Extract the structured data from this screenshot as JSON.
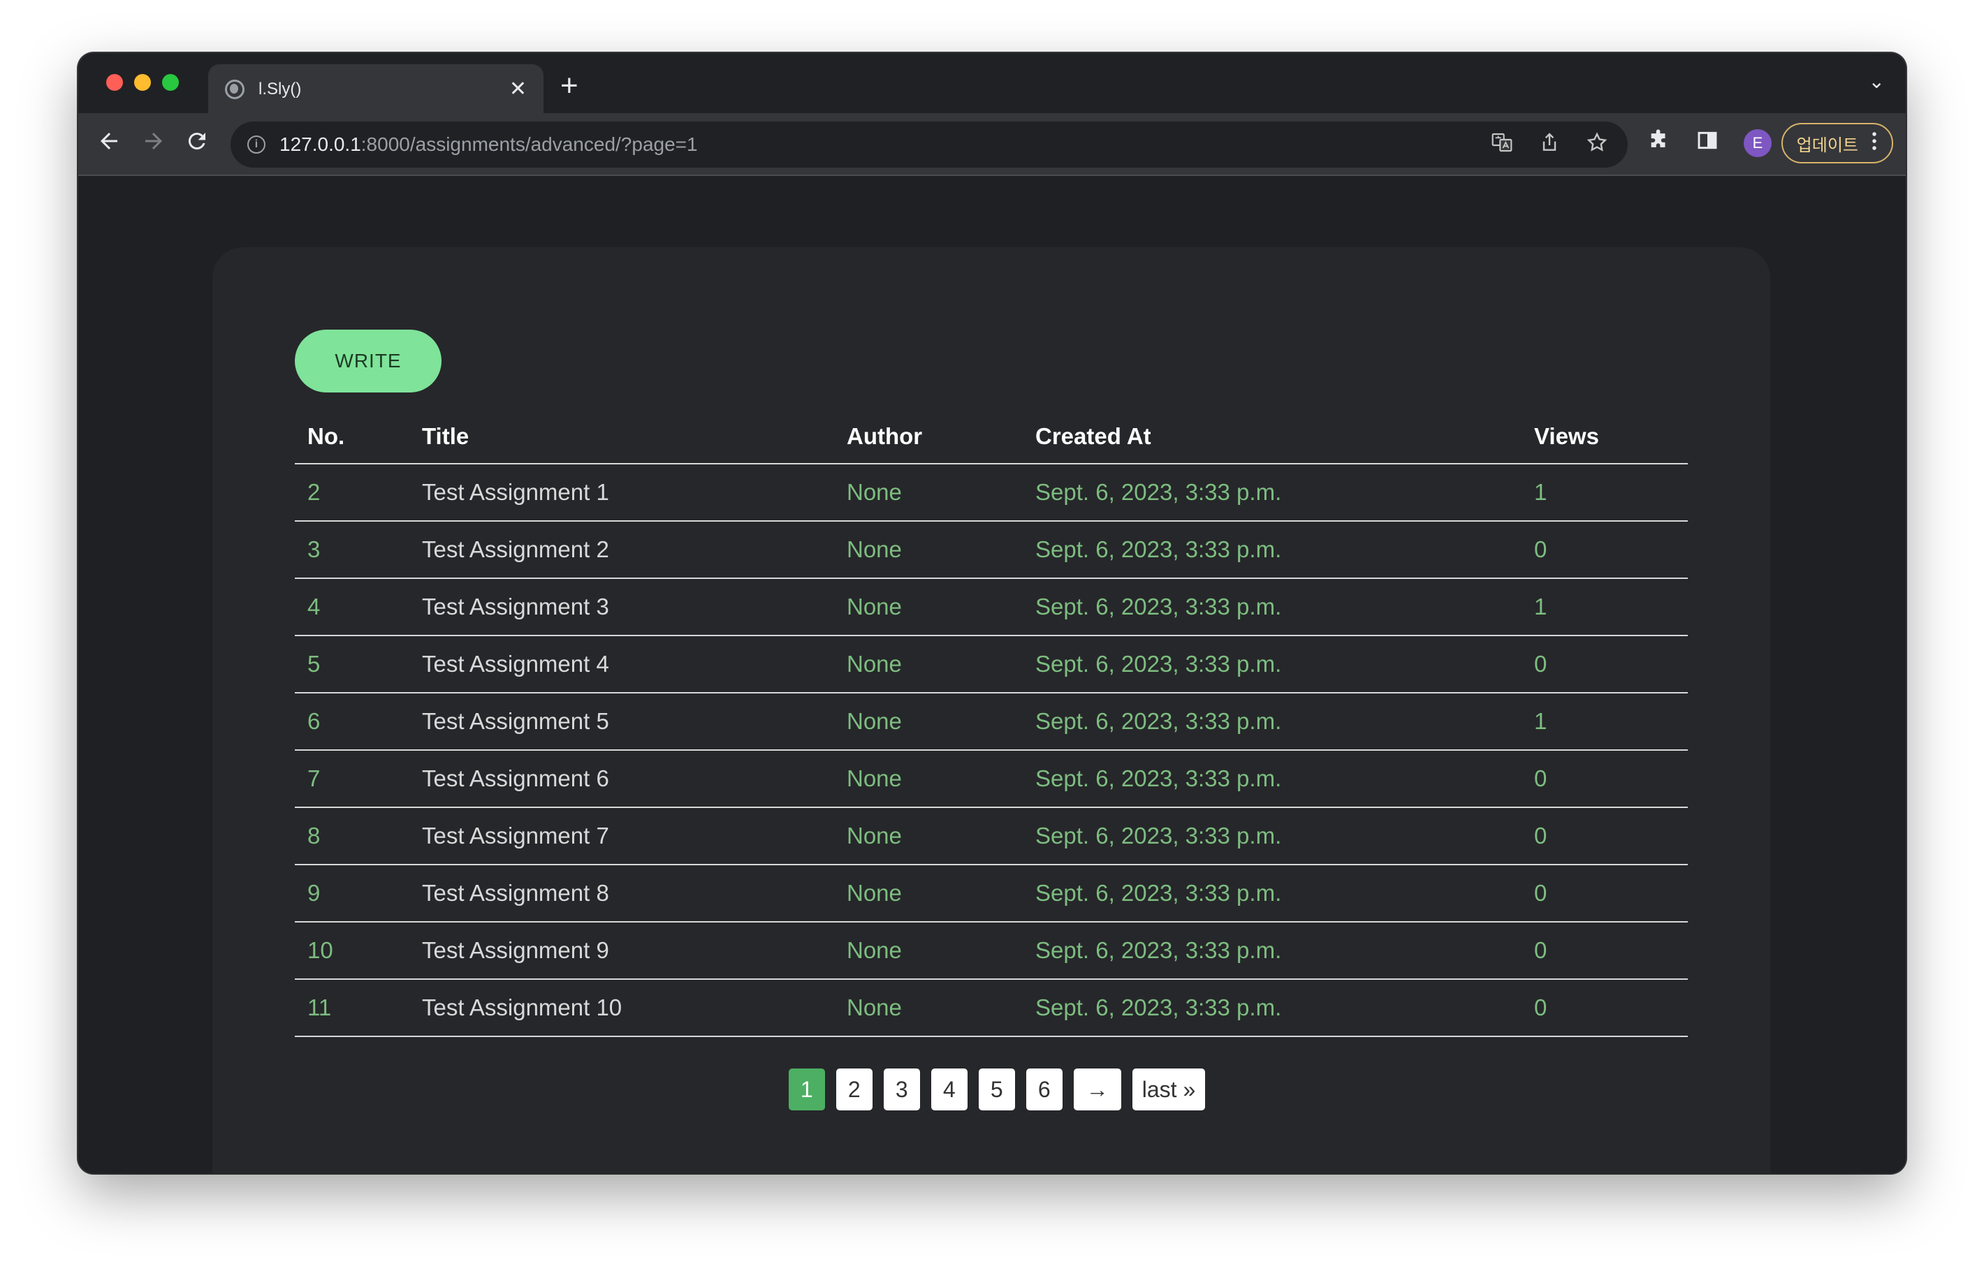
{
  "browser": {
    "tab_title": "l.Sly()",
    "tab_close": "✕",
    "new_tab": "+",
    "tabs_menu": "⌄",
    "url_host": "127.0.0.1",
    "url_rest": ":8000/assignments/advanced/?page=1",
    "avatar_initial": "E",
    "update_label": "업데이트",
    "icons": [
      "translate-icon",
      "share-icon",
      "bookmark-star-icon",
      "extensions-icon",
      "sidepanel-icon",
      "profile-avatar",
      "kebab-menu-icon"
    ]
  },
  "page": {
    "write_label": "WRITE",
    "columns": {
      "no": "No.",
      "title": "Title",
      "author": "Author",
      "created": "Created At",
      "views": "Views"
    },
    "rows": [
      {
        "no": "2",
        "title": "Test Assignment 1",
        "author": "None",
        "created": "Sept. 6, 2023, 3:33 p.m.",
        "views": "1"
      },
      {
        "no": "3",
        "title": "Test Assignment 2",
        "author": "None",
        "created": "Sept. 6, 2023, 3:33 p.m.",
        "views": "0"
      },
      {
        "no": "4",
        "title": "Test Assignment 3",
        "author": "None",
        "created": "Sept. 6, 2023, 3:33 p.m.",
        "views": "1"
      },
      {
        "no": "5",
        "title": "Test Assignment 4",
        "author": "None",
        "created": "Sept. 6, 2023, 3:33 p.m.",
        "views": "0"
      },
      {
        "no": "6",
        "title": "Test Assignment 5",
        "author": "None",
        "created": "Sept. 6, 2023, 3:33 p.m.",
        "views": "1"
      },
      {
        "no": "7",
        "title": "Test Assignment 6",
        "author": "None",
        "created": "Sept. 6, 2023, 3:33 p.m.",
        "views": "0"
      },
      {
        "no": "8",
        "title": "Test Assignment 7",
        "author": "None",
        "created": "Sept. 6, 2023, 3:33 p.m.",
        "views": "0"
      },
      {
        "no": "9",
        "title": "Test Assignment 8",
        "author": "None",
        "created": "Sept. 6, 2023, 3:33 p.m.",
        "views": "0"
      },
      {
        "no": "10",
        "title": "Test Assignment 9",
        "author": "None",
        "created": "Sept. 6, 2023, 3:33 p.m.",
        "views": "0"
      },
      {
        "no": "11",
        "title": "Test Assignment 10",
        "author": "None",
        "created": "Sept. 6, 2023, 3:33 p.m.",
        "views": "0"
      }
    ],
    "pagination": {
      "pages": [
        "1",
        "2",
        "3",
        "4",
        "5",
        "6"
      ],
      "current": "1",
      "next": "→",
      "last": "last »"
    }
  },
  "colors": {
    "accent_green": "#7fe39a",
    "link_green": "#7dbd80",
    "active_page": "#4caf63"
  }
}
